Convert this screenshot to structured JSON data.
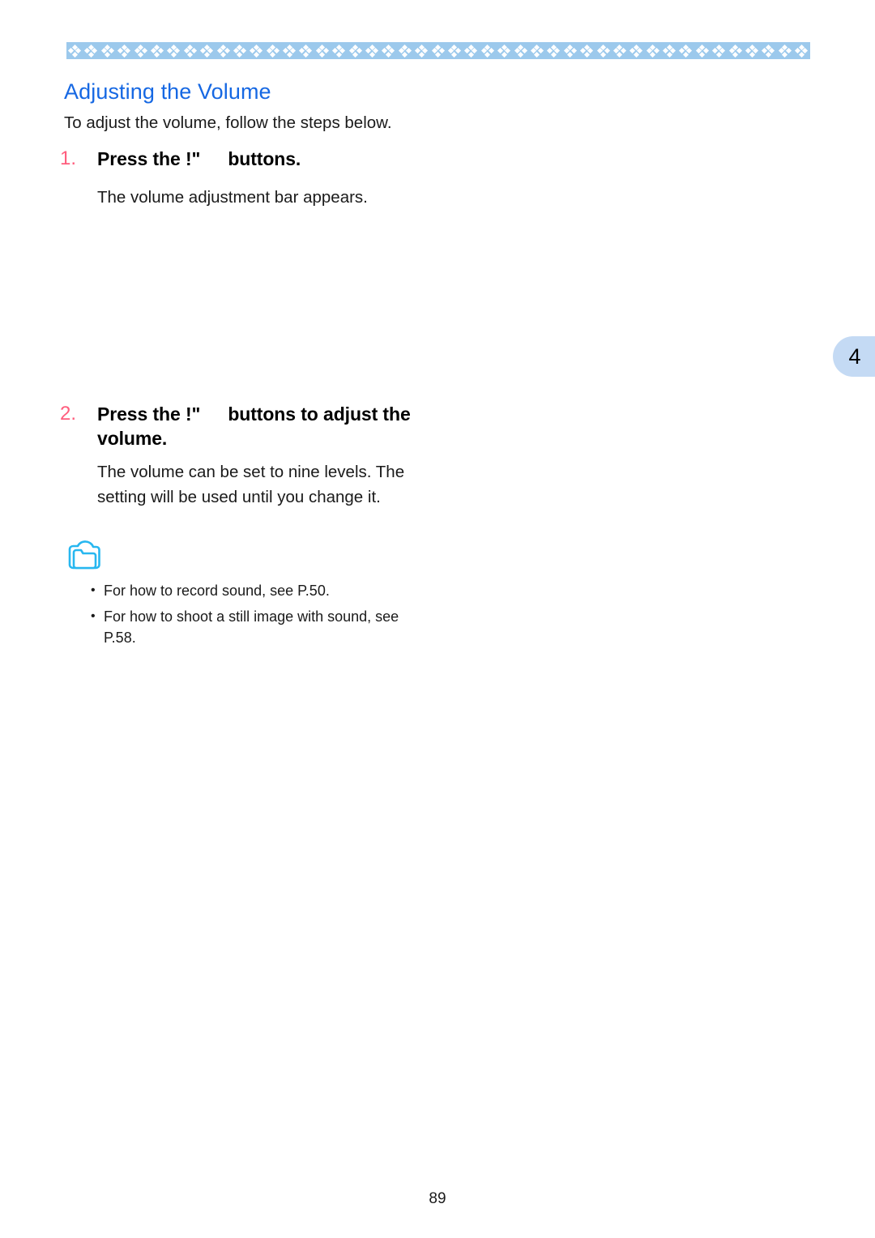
{
  "page": {
    "number": "89",
    "chapter_tab": "4",
    "accent_blue": "#1668e3",
    "band_blue": "#9cc9ec",
    "tab_blue": "#c4daf4",
    "step_number_pink": "#ff5d7d",
    "note_icon_cyan": "#27b7f0"
  },
  "section": {
    "title": "Adjusting the Volume",
    "intro": "To adjust the volume, follow the steps below."
  },
  "steps": [
    {
      "number": "1.",
      "heading_before": "Press the !\"",
      "heading_after": "buttons.",
      "body": "The volume adjustment bar appears."
    },
    {
      "number": "2.",
      "heading_before": "Press the !\"",
      "heading_after": "buttons to adjust the volume.",
      "body": "The volume can be set to nine levels. The setting will be used until you change it."
    }
  ],
  "note": {
    "icon": "note-memo-icon",
    "bullet": "•",
    "items": [
      "For how to record sound, see P.50.",
      "For how to shoot a still image with sound, see P.58."
    ]
  }
}
